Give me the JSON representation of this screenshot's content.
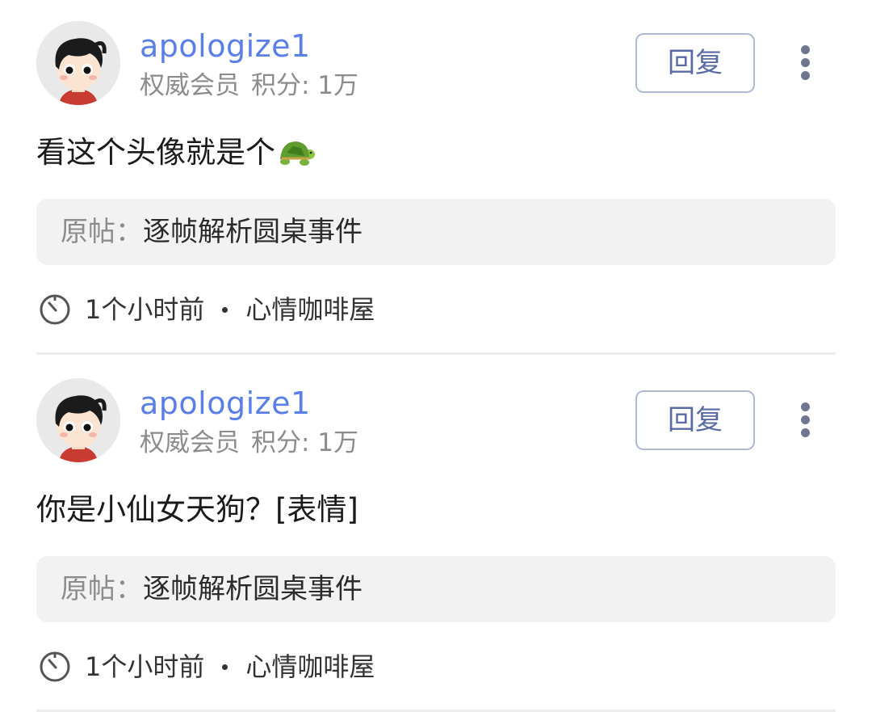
{
  "posts": [
    {
      "username": "apologize1",
      "member_level": "权威会员",
      "points": "积分: 1万",
      "reply_label": "回复",
      "content": "看这个头像就是个",
      "content_emoji": "turtle-emoji",
      "original_label": "原帖：",
      "original_title": "逐帧解析圆桌事件",
      "time": "1个小时前",
      "board": "心情咖啡屋"
    },
    {
      "username": "apologize1",
      "member_level": "权威会员",
      "points": "积分: 1万",
      "reply_label": "回复",
      "content": "你是小仙女天狗？[表情]",
      "original_label": "原帖：",
      "original_title": "逐帧解析圆桌事件",
      "time": "1个小时前",
      "board": "心情咖啡屋"
    }
  ],
  "icons": {
    "more": "more-vertical-icon",
    "clock": "clock-icon"
  },
  "colors": {
    "username": "#5b7fe8",
    "reply_border": "#aeb9d8",
    "reply_text": "#5a6aa6",
    "muted": "#8c8c8c",
    "card_bg": "#f2f2f2"
  }
}
